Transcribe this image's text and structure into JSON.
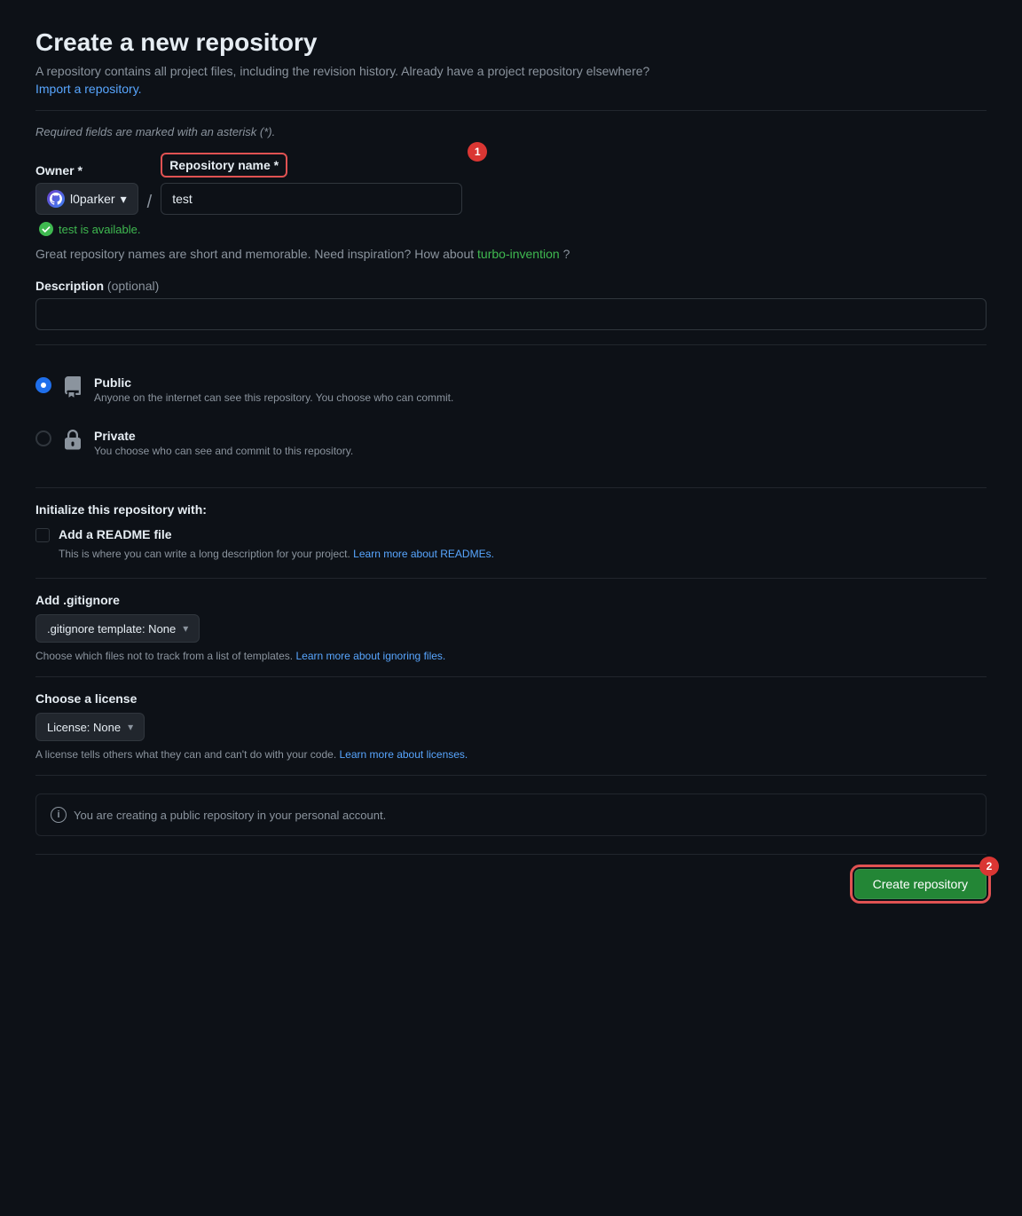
{
  "page": {
    "title": "Create a new repository",
    "subtitle": "A repository contains all project files, including the revision history. Already have a project repository elsewhere?",
    "import_link": "Import a repository.",
    "required_notice": "Required fields are marked with an asterisk (*)."
  },
  "owner_field": {
    "label": "Owner",
    "required": "*",
    "owner_name": "l0parker",
    "dropdown_icon": "▾"
  },
  "repo_name_field": {
    "label": "Repository name",
    "required": "*",
    "value": "test",
    "available_msg": "test is available.",
    "badge": "1"
  },
  "inspiration": {
    "prefix": "Great repository names are short and memorable. Need inspiration? How about",
    "suggestion": "turbo-invention",
    "suffix": "?"
  },
  "description_field": {
    "label": "Description",
    "optional": "(optional)",
    "placeholder": ""
  },
  "visibility": {
    "options": [
      {
        "id": "public",
        "label": "Public",
        "description": "Anyone on the internet can see this repository. You choose who can commit.",
        "checked": true
      },
      {
        "id": "private",
        "label": "Private",
        "description": "You choose who can see and commit to this repository.",
        "checked": false
      }
    ]
  },
  "init_section": {
    "title": "Initialize this repository with:",
    "readme": {
      "label": "Add a README file",
      "description": "This is where you can write a long description for your project.",
      "link_text": "Learn more about READMEs.",
      "checked": false
    }
  },
  "gitignore_section": {
    "title": "Add .gitignore",
    "select_label": ".gitignore template: None",
    "description": "Choose which files not to track from a list of templates.",
    "link_text": "Learn more about ignoring files."
  },
  "license_section": {
    "title": "Choose a license",
    "select_label": "License: None",
    "description": "A license tells others what they can and can't do with your code.",
    "link_text": "Learn more about licenses."
  },
  "info_box": {
    "text": "You are creating a public repository in your personal account."
  },
  "submit": {
    "label": "Create repository",
    "badge": "2"
  }
}
